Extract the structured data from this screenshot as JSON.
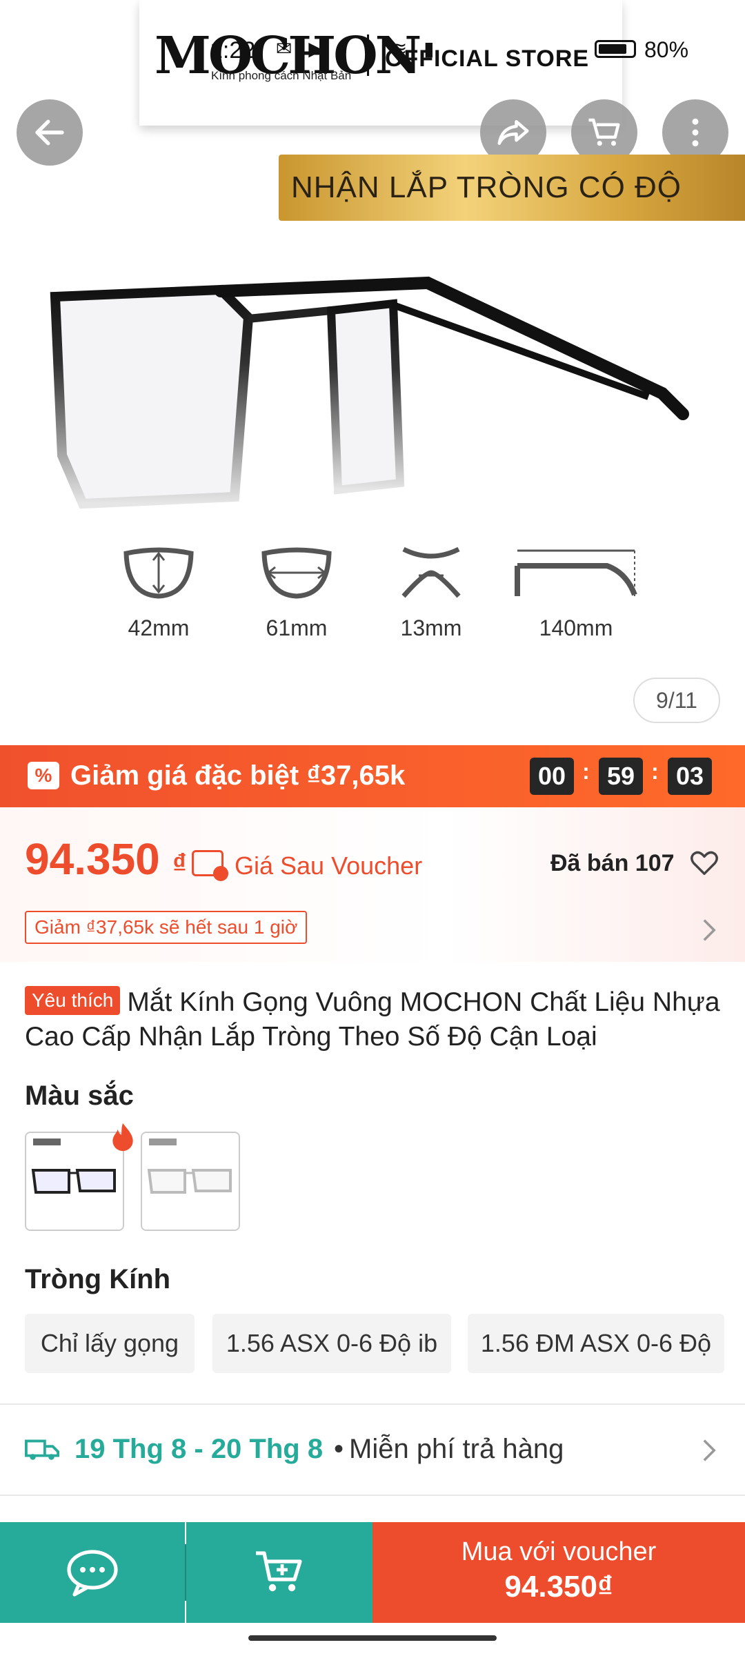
{
  "status_bar": {
    "time": "1:22",
    "battery": "80%"
  },
  "brand": {
    "logo": "MOCHON",
    "tagline": "Kính phong cách Nhật Bản",
    "official": "OFFICIAL STORE"
  },
  "banner": {
    "text": "NHẬN LẮP TRÒNG CÓ ĐỘ"
  },
  "measurements": [
    {
      "label": "42mm",
      "icon": "lens-height-icon"
    },
    {
      "label": "61mm",
      "icon": "lens-width-icon"
    },
    {
      "label": "13mm",
      "icon": "bridge-width-icon"
    },
    {
      "label": "140mm",
      "icon": "temple-length-icon"
    }
  ],
  "image_counter": "9/11",
  "flash_sale": {
    "label": "Giảm giá đặc biệt ₫37,65k",
    "timer": {
      "hours": "00",
      "minutes": "59",
      "seconds": "03"
    }
  },
  "price": {
    "amount": "94.350",
    "currency": "₫",
    "after_voucher_label": "Giá Sau Voucher",
    "sold": "Đã bán 107",
    "discount_note": "Giảm ₫37,65k sẽ hết sau 1 giờ"
  },
  "product": {
    "badge": "Yêu thích",
    "title": "Mắt Kính Gọng Vuông MOCHON Chất Liệu Nhựa Cao Cấp Nhận Lắp Tròng Theo Số Độ Cận Loại"
  },
  "color_section": {
    "label": "Màu sắc"
  },
  "lens_section": {
    "label": "Tròng Kính",
    "options": [
      "Chỉ lấy gọng",
      "1.56 ASX 0-6 Độ ib",
      "1.56 ĐM ASX 0-6 Độ"
    ]
  },
  "shipping": {
    "date_range": "19 Thg 8 - 20 Thg 8",
    "separator": "•",
    "free_return": "Miễn phí trả hàng"
  },
  "bottom_bar": {
    "buy_label": "Mua với voucher",
    "buy_price": "94.350₫"
  },
  "colors": {
    "accent": "#ee4d2d",
    "teal": "#26aa99",
    "flash_bar": "#f0512d"
  }
}
